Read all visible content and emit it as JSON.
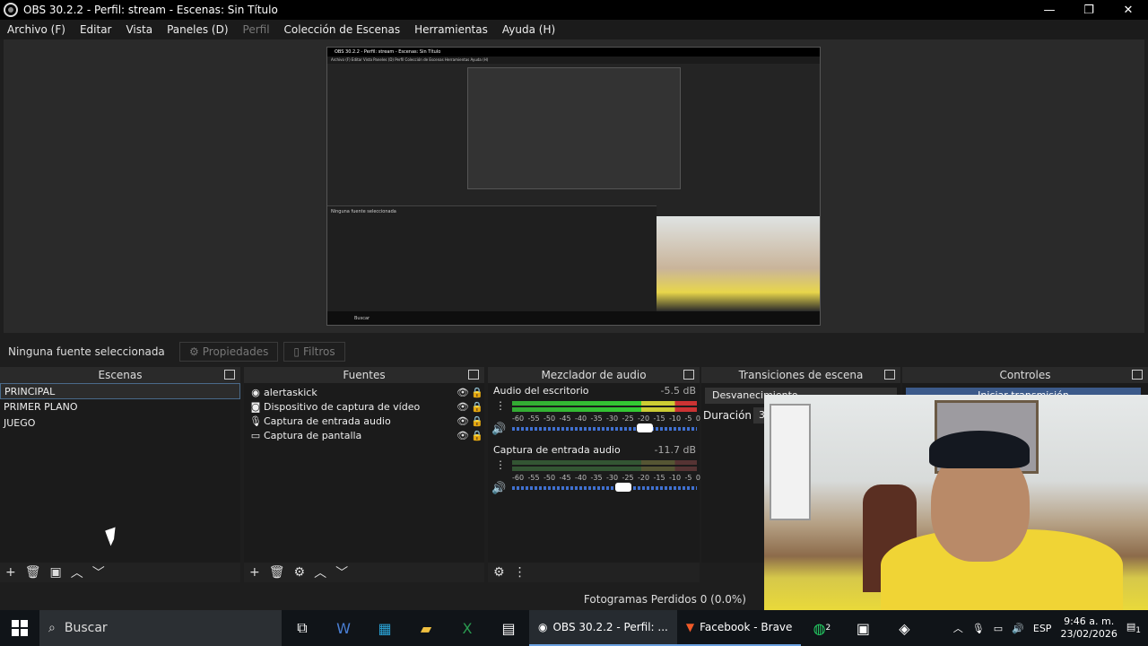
{
  "window": {
    "title": "OBS 30.2.2 - Perfil: stream - Escenas: Sin Título",
    "minimize": "—",
    "restore": "❐",
    "close": "✕"
  },
  "menu": [
    "Archivo (F)",
    "Editar",
    "Vista",
    "Paneles (D)",
    "Perfil",
    "Colección de Escenas",
    "Herramientas",
    "Ayuda (H)"
  ],
  "sourcebar": {
    "status": "Ninguna fuente seleccionada",
    "properties": "Propiedades",
    "filters": "Filtros"
  },
  "docks": {
    "scenes": "Escenas",
    "sources": "Fuentes",
    "mixer": "Mezclador de audio",
    "transitions": "Transiciones de escena",
    "controls": "Controles"
  },
  "scenes": [
    "PRINCIPAL",
    "PRIMER PLANO",
    "JUEGO"
  ],
  "sources": [
    {
      "name": "alertaskick",
      "icon": "globe-icon"
    },
    {
      "name": "Dispositivo de captura de vídeo",
      "icon": "camera-icon"
    },
    {
      "name": "Captura de entrada audio",
      "icon": "microphone-icon"
    },
    {
      "name": "Captura de pantalla",
      "icon": "monitor-icon"
    }
  ],
  "mixer": [
    {
      "name": "Audio del escritorio",
      "db": "-5.5 dB",
      "level": 0.72
    },
    {
      "name": "Captura de entrada audio",
      "db": "-11.7 dB",
      "level": 0.6
    }
  ],
  "mixer_scale": [
    "-60",
    "-55",
    "-50",
    "-45",
    "-40",
    "-35",
    "-30",
    "-25",
    "-20",
    "-15",
    "-10",
    "-5",
    "0"
  ],
  "transitions": {
    "selected": "Desvanecimiento",
    "duration_label": "Duración",
    "duration_value": "3"
  },
  "controls": {
    "first_button": "Iniciar transmisión"
  },
  "status": {
    "frames": "Fotogramas Perdidos 0 (0.0%)"
  },
  "taskbar": {
    "search": "Buscar",
    "obs": "OBS 30.2.2 - Perfil: ...",
    "brave": "Facebook - Brave",
    "whatsapp_badge": "2",
    "language": "ESP",
    "time": "9:46 a. m.",
    "date": "23/02/2026",
    "notifications": "1"
  },
  "preview": {
    "title": "OBS 30.2.2 - Perfil: stream - Escenas: Sin Título",
    "menu": "Archivo (F)  Editar  Vista  Paneles (D)  Perfil  Colección de Escenas  Herramientas  Ayuda (H)",
    "status": "Ninguna fuente seleccionada",
    "taskbar": "Buscar"
  }
}
